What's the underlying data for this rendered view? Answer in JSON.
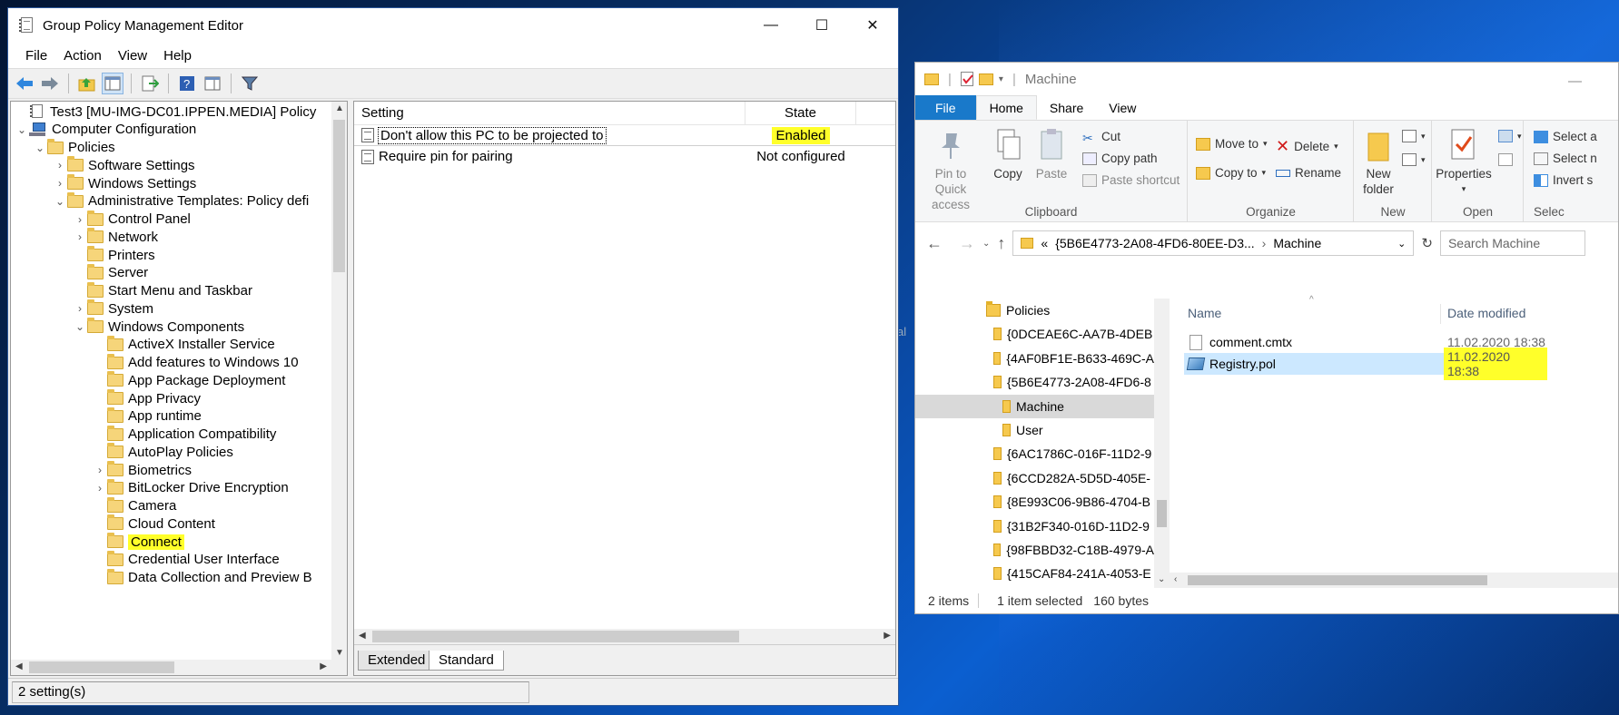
{
  "gpme": {
    "title": "Group Policy Management Editor",
    "window_buttons": {
      "minimize": "—",
      "maximize": "☐",
      "close": "✕"
    },
    "menu": [
      "File",
      "Action",
      "View",
      "Help"
    ],
    "tree": [
      {
        "label": "Test3 [MU-IMG-DC01.IPPEN.MEDIA] Policy",
        "icon": "gpo-icon",
        "chev": ""
      },
      {
        "label": "Computer Configuration",
        "icon": "computer-icon",
        "chev": "⌄"
      },
      {
        "label": "Policies",
        "icon": "folder-icon",
        "chev": "⌄"
      },
      {
        "label": "Software Settings",
        "icon": "folder-icon",
        "chev": "›"
      },
      {
        "label": "Windows Settings",
        "icon": "folder-icon",
        "chev": "›"
      },
      {
        "label": "Administrative Templates: Policy defi",
        "icon": "folder-icon",
        "chev": "⌄"
      },
      {
        "label": "Control Panel",
        "icon": "folder-icon",
        "chev": "›"
      },
      {
        "label": "Network",
        "icon": "folder-icon",
        "chev": "›"
      },
      {
        "label": "Printers",
        "icon": "folder-icon",
        "chev": ""
      },
      {
        "label": "Server",
        "icon": "folder-icon",
        "chev": ""
      },
      {
        "label": "Start Menu and Taskbar",
        "icon": "folder-icon",
        "chev": ""
      },
      {
        "label": "System",
        "icon": "folder-icon",
        "chev": "›"
      },
      {
        "label": "Windows Components",
        "icon": "folder-icon",
        "chev": "⌄"
      },
      {
        "label": "ActiveX Installer Service",
        "icon": "folder-icon",
        "chev": ""
      },
      {
        "label": "Add features to Windows 10",
        "icon": "folder-icon",
        "chev": ""
      },
      {
        "label": "App Package Deployment",
        "icon": "folder-icon",
        "chev": ""
      },
      {
        "label": "App Privacy",
        "icon": "folder-icon",
        "chev": ""
      },
      {
        "label": "App runtime",
        "icon": "folder-icon",
        "chev": ""
      },
      {
        "label": "Application Compatibility",
        "icon": "folder-icon",
        "chev": ""
      },
      {
        "label": "AutoPlay Policies",
        "icon": "folder-icon",
        "chev": ""
      },
      {
        "label": "Biometrics",
        "icon": "folder-icon",
        "chev": "›"
      },
      {
        "label": "BitLocker Drive Encryption",
        "icon": "folder-icon",
        "chev": "›"
      },
      {
        "label": "Camera",
        "icon": "folder-icon",
        "chev": ""
      },
      {
        "label": "Cloud Content",
        "icon": "folder-icon",
        "chev": ""
      },
      {
        "label": "Connect",
        "icon": "folder-icon",
        "chev": "",
        "highlight": true
      },
      {
        "label": "Credential User Interface",
        "icon": "folder-icon",
        "chev": ""
      },
      {
        "label": "Data Collection and Preview B",
        "icon": "folder-icon",
        "chev": ""
      }
    ],
    "columns": {
      "setting": "Setting",
      "state": "State"
    },
    "settings": [
      {
        "name": "Don't allow this PC to be projected to",
        "state": "Enabled",
        "selected": true,
        "highlight": true
      },
      {
        "name": "Require pin for pairing",
        "state": "Not configured"
      }
    ],
    "tabs": [
      "Extended",
      "Standard"
    ],
    "status": "2 setting(s)"
  },
  "explorer": {
    "title": "Machine",
    "ribbon_tabs": [
      "File",
      "Home",
      "Share",
      "View"
    ],
    "clipboard": {
      "label": "Clipboard",
      "pin": "Pin to Quick access",
      "copy": "Copy",
      "paste": "Paste",
      "cut": "Cut",
      "copy_path": "Copy path",
      "paste_shortcut": "Paste shortcut"
    },
    "organize": {
      "label": "Organize",
      "move_to": "Move to",
      "copy_to": "Copy to",
      "delete": "Delete",
      "rename": "Rename"
    },
    "new": {
      "label": "New",
      "new_folder": "New folder"
    },
    "open": {
      "label": "Open",
      "properties": "Properties"
    },
    "select": {
      "label": "Selec",
      "select_all": "Select a",
      "select_none": "Select n",
      "invert": "Invert s"
    },
    "address": {
      "prefix": "«",
      "crumb1": "{5B6E4773-2A08-4FD6-80EE-D3...",
      "crumb2": "Machine"
    },
    "search_placeholder": "Search Machine",
    "nav": [
      {
        "label": "Policies",
        "selected": false
      },
      {
        "label": "{0DCEAE6C-AA7B-4DEB",
        "selected": false
      },
      {
        "label": "{4AF0BF1E-B633-469C-A",
        "selected": false
      },
      {
        "label": "{5B6E4773-2A08-4FD6-8",
        "selected": false
      },
      {
        "label": "Machine",
        "selected": true
      },
      {
        "label": "User",
        "selected": false
      },
      {
        "label": "{6AC1786C-016F-11D2-9",
        "selected": false
      },
      {
        "label": "{6CCD282A-5D5D-405E-",
        "selected": false
      },
      {
        "label": "{8E993C06-9B86-4704-B",
        "selected": false
      },
      {
        "label": "{31B2F340-016D-11D2-9",
        "selected": false
      },
      {
        "label": "{98FBBD32-C18B-4979-A",
        "selected": false
      },
      {
        "label": "{415CAF84-241A-4053-E",
        "selected": false
      }
    ],
    "columns": {
      "name": "Name",
      "date": "Date modified"
    },
    "files": [
      {
        "name": "comment.cmtx",
        "date": "11.02.2020 18:38",
        "selected": false
      },
      {
        "name": "Registry.pol",
        "date": "11.02.2020 18:38",
        "selected": true
      }
    ],
    "status": {
      "count": "2 items",
      "selected": "1 item selected",
      "size": "160 bytes"
    }
  },
  "desktop": {
    "behind_text": "al"
  },
  "colors": {
    "highlight": "#ffff2a",
    "accent": "#1979ca",
    "title_border": "#2b579a"
  }
}
